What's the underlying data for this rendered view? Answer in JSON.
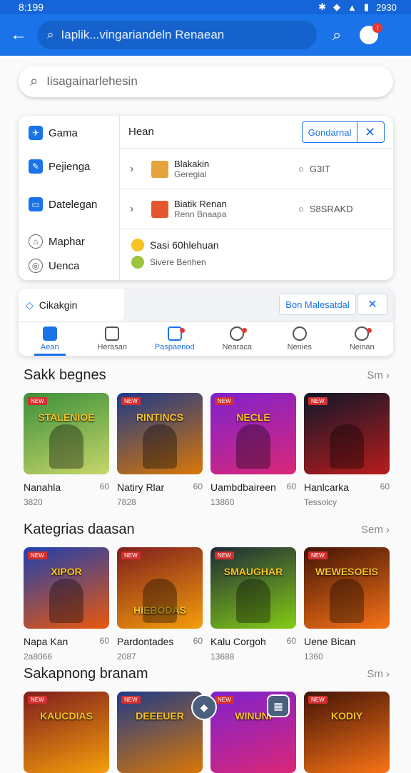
{
  "status": {
    "time": "8:199",
    "battery": "2930"
  },
  "appbar": {
    "search_text": "Iaplik...vingariandeln Renaean"
  },
  "search": {
    "placeholder": "Iisagainarlehesin"
  },
  "menu": [
    {
      "label": "Gama",
      "icon": "plane-icon"
    },
    {
      "label": "Pejienga",
      "icon": "edit-icon"
    },
    {
      "label": "Datelegan",
      "icon": "monitor-icon"
    },
    {
      "label": "Maphar",
      "icon": "map-icon"
    },
    {
      "label": "Uenca",
      "icon": "compass-icon"
    }
  ],
  "panel": {
    "header": "Hean",
    "button": "Gondarnal",
    "rows": [
      {
        "title": "Blakakin",
        "sub": "Geregial",
        "meta": "G3IT"
      },
      {
        "title": "Biatik Renan",
        "sub": "Renn Bnaapa",
        "meta": "S8SRAKD"
      }
    ],
    "list": [
      {
        "label": "Sasi 60hlehuan"
      },
      {
        "label": "Sivere Benhen"
      }
    ]
  },
  "tabs": {
    "label": "Cikakgin",
    "button": "Bon Malesatdal",
    "nav": [
      {
        "label": "Aean",
        "active": true
      },
      {
        "label": "Herasan",
        "active": false
      },
      {
        "label": "Paspaeriod",
        "active": false
      },
      {
        "label": "Nearaca",
        "active": false
      },
      {
        "label": "Nenies",
        "active": false
      },
      {
        "label": "Neinan",
        "active": false
      }
    ]
  },
  "sections": [
    {
      "title": "Sakk begnes",
      "see": "Sm",
      "cards": [
        {
          "img_title": "STALENIOE",
          "name": "Nanahla",
          "rating": "60",
          "count": "3820"
        },
        {
          "img_title": "RINTINCS",
          "name": "Natiry Rlar",
          "rating": "60",
          "count": "7828"
        },
        {
          "img_title": "NECLE",
          "name": "Uambdbaireen",
          "rating": "60",
          "count": "13860"
        },
        {
          "img_title": "",
          "name": "Hanlcarka",
          "rating": "60",
          "count": "Tessolcy"
        }
      ]
    },
    {
      "title": "Kategrias daasan",
      "see": "Sem",
      "cards": [
        {
          "img_title": "XIPOR",
          "name": "Napa Kan",
          "rating": "60",
          "count": "2a8066"
        },
        {
          "img_title": "HIEBODAS",
          "name": "Pardontades",
          "rating": "60",
          "count": "2087"
        },
        {
          "img_title": "SMAUGHAR",
          "name": "Kalu Corgoh",
          "rating": "60",
          "count": "13688"
        },
        {
          "img_title": "WEWESOEIS",
          "name": "Uene Bican",
          "rating": "",
          "count": "1360"
        }
      ]
    },
    {
      "title": "Sakapnong branam",
      "see": "Sm",
      "cards": [
        {
          "img_title": "KAUCDIAS"
        },
        {
          "img_title": "DEEEUER"
        },
        {
          "img_title": "WINUNI"
        },
        {
          "img_title": "KODIY"
        }
      ]
    }
  ]
}
